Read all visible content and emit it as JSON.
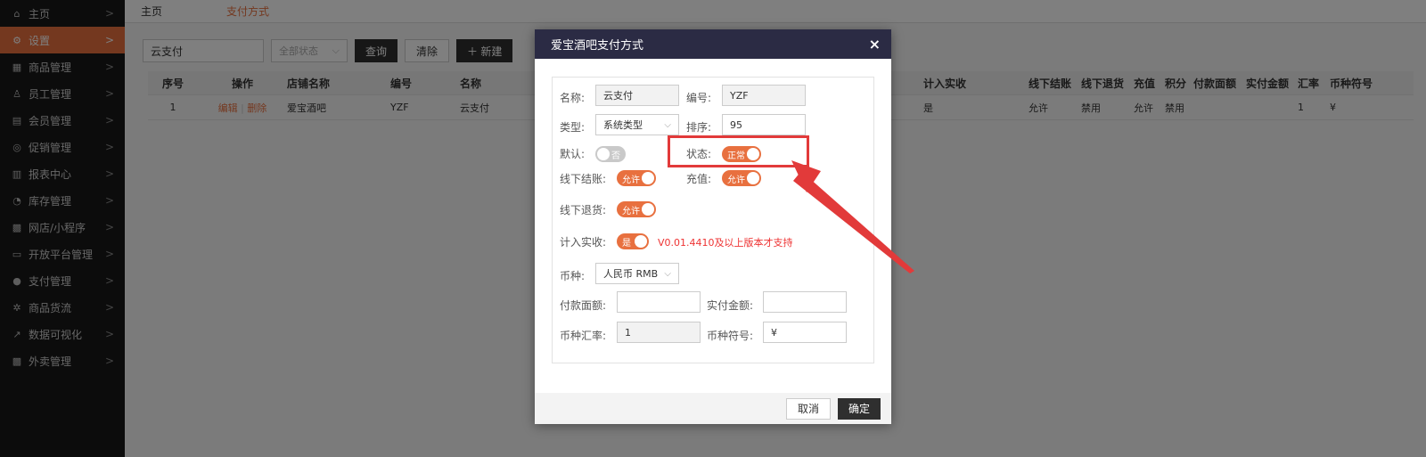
{
  "sidebar": {
    "items": [
      {
        "label": "主页",
        "icon": "home-icon",
        "glyph": "⌂"
      },
      {
        "label": "设置",
        "icon": "gear-icon",
        "glyph": "⚙"
      },
      {
        "label": "商品管理",
        "icon": "keyboard-icon",
        "glyph": "▦"
      },
      {
        "label": "员工管理",
        "icon": "user-icon",
        "glyph": "♙"
      },
      {
        "label": "会员管理",
        "icon": "member-card-icon",
        "glyph": "▤"
      },
      {
        "label": "促销管理",
        "icon": "check-circle-icon",
        "glyph": "◎"
      },
      {
        "label": "报表中心",
        "icon": "bar-chart-icon",
        "glyph": "▥"
      },
      {
        "label": "库存管理",
        "icon": "pie-chart-icon",
        "glyph": "◔"
      },
      {
        "label": "网店/小程序",
        "icon": "store-icon",
        "glyph": "▩"
      },
      {
        "label": "开放平台管理",
        "icon": "monitor-icon",
        "glyph": "▭"
      },
      {
        "label": "支付管理",
        "icon": "yen-circle-icon",
        "glyph": "●"
      },
      {
        "label": "商品货流",
        "icon": "flow-icon",
        "glyph": "✲"
      },
      {
        "label": "数据可视化",
        "icon": "line-chart-icon",
        "glyph": "↗"
      },
      {
        "label": "外卖管理",
        "icon": "takeout-store-icon",
        "glyph": "▩"
      }
    ],
    "chevron": ">"
  },
  "tabs": {
    "home": "主页",
    "current": "支付方式"
  },
  "toolbar": {
    "search_value": "云支付",
    "status_select": "全部状态",
    "query": "查询",
    "clear": "清除",
    "add": "＋ 新建"
  },
  "table": {
    "headers": {
      "seq": "序号",
      "op": "操作",
      "store": "店铺名称",
      "code": "编号",
      "name": "名称",
      "actual": "计入实收",
      "offline_checkout": "线下结账",
      "offline_return": "线下退货",
      "recharge": "充值",
      "points": "积分",
      "pay_face": "付款面额",
      "pay_amount": "实付金额",
      "rate": "汇率",
      "symbol": "币种符号"
    },
    "row": {
      "seq": "1",
      "edit": "编辑",
      "sep": "|",
      "delete": "删除",
      "store": "爱宝酒吧",
      "code": "YZF",
      "name": "云支付",
      "actual": "是",
      "offline_checkout": "允许",
      "offline_return": "禁用",
      "recharge": "允许",
      "points": "禁用",
      "pay_face": "",
      "pay_amount": "",
      "rate": "1",
      "symbol": "¥"
    }
  },
  "modal": {
    "title": "爱宝酒吧支付方式",
    "close": "×",
    "labels": {
      "name": "名称:",
      "code": "编号:",
      "type": "类型:",
      "order": "排序:",
      "default": "默认:",
      "status": "状态:",
      "offline_checkout": "线下结账:",
      "recharge": "充值:",
      "offline_return": "线下退货:",
      "actual": "计入实收:",
      "currency": "币种:",
      "pay_face": "付款面额:",
      "pay_amount": "实付金额:",
      "rate": "币种汇率:",
      "symbol": "币种符号:"
    },
    "values": {
      "name": "云支付",
      "code": "YZF",
      "type": "系统类型",
      "order": "95",
      "currency": "人民币 RMB",
      "pay_face": "",
      "pay_amount": "",
      "rate": "1",
      "symbol": "¥"
    },
    "switches": {
      "default": {
        "text": "否",
        "on": false
      },
      "status": {
        "text": "正常",
        "on": true
      },
      "offline_checkout": {
        "text": "允许",
        "on": true
      },
      "recharge": {
        "text": "允许",
        "on": true
      },
      "offline_return": {
        "text": "允许",
        "on": true
      },
      "actual": {
        "text": "是",
        "on": true
      }
    },
    "version_note": "V0.01.4410及以上版本才支持",
    "cancel": "取消",
    "confirm": "确定"
  },
  "colors": {
    "accent": "#e8703f",
    "highlight": "#e23a3a",
    "header": "#2b2b44"
  }
}
